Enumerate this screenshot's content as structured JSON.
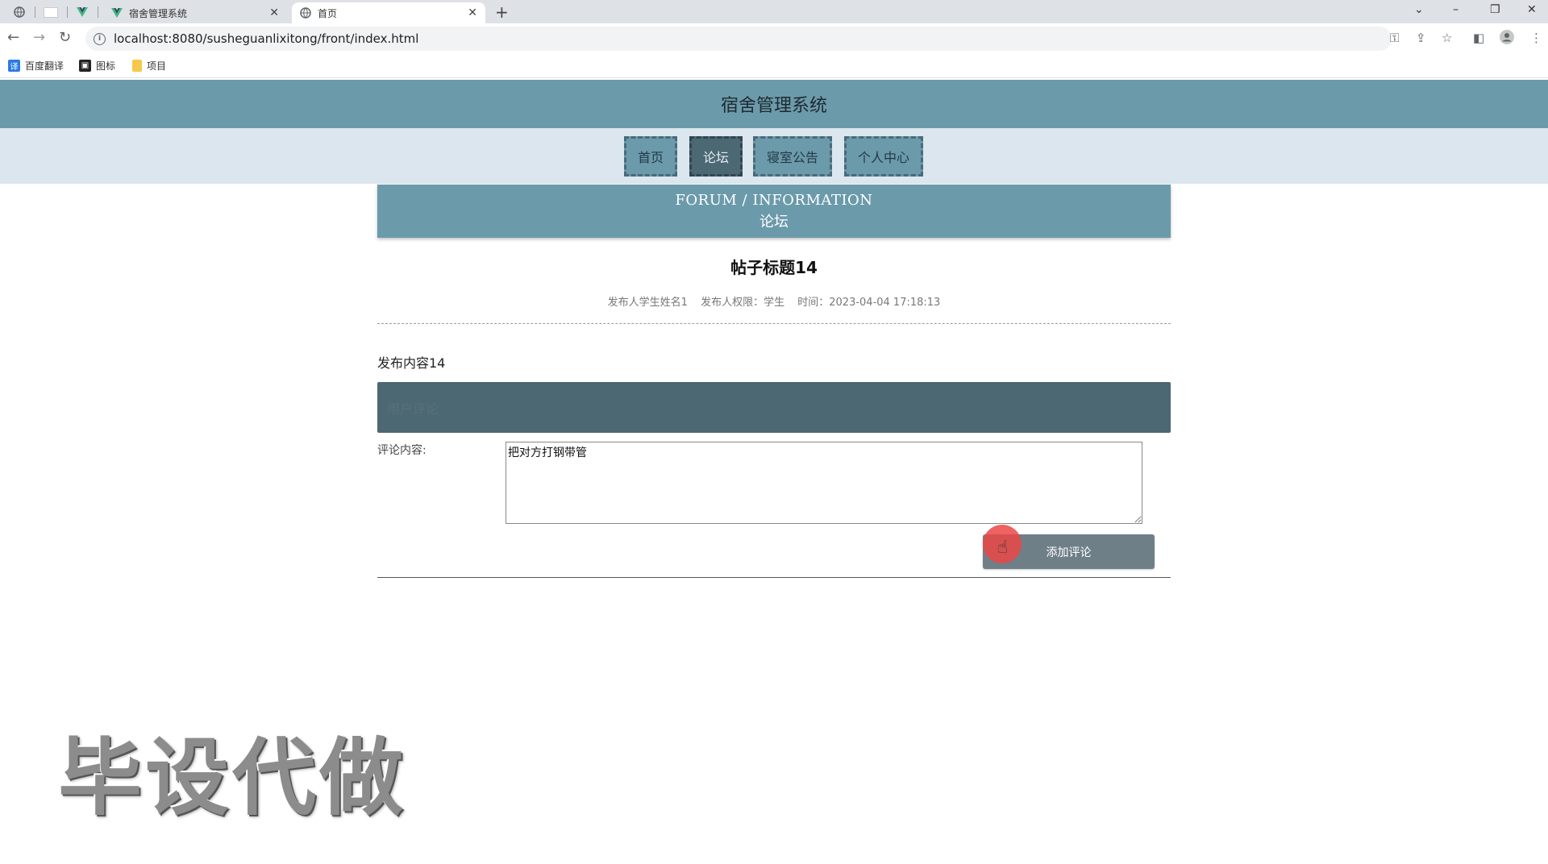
{
  "browser": {
    "tabs": [
      {
        "title": "宿舍管理系统",
        "icon": "vue-icon"
      },
      {
        "title": "首页",
        "icon": "globe-icon"
      }
    ],
    "close_glyph": "✕",
    "new_tab_glyph": "+",
    "url": "localhost:8080/susheguanlixitong/front/index.html",
    "bookmarks": [
      {
        "label": "百度翻译",
        "icon": "translate-icon"
      },
      {
        "label": "图标",
        "icon": "image-icon"
      },
      {
        "label": "项目",
        "icon": "folder-icon"
      }
    ]
  },
  "site": {
    "title": "宿舍管理系统",
    "nav": [
      {
        "label": "首页"
      },
      {
        "label": "论坛"
      },
      {
        "label": "寝室公告"
      },
      {
        "label": "个人中心"
      }
    ],
    "active_nav": "论坛"
  },
  "banner": {
    "en": "FORUM / INFORMATION",
    "cn": "论坛"
  },
  "post": {
    "title": "帖子标题14",
    "author": "发布人学生姓名1",
    "role": "发布人权限：学生",
    "time": "时间：2023-04-04 17:18:13",
    "content": "发布内容14"
  },
  "comment": {
    "bar_label": "用户评论",
    "label": "评论内容:",
    "value": "把对方打钢带管",
    "submit_label": "添加评论"
  },
  "watermark": "毕设代做",
  "colors": {
    "header": "#6b9aab",
    "nav_bg": "#dbe6ee",
    "active_nav": "#4c6873",
    "submit": "#6f7f88"
  }
}
